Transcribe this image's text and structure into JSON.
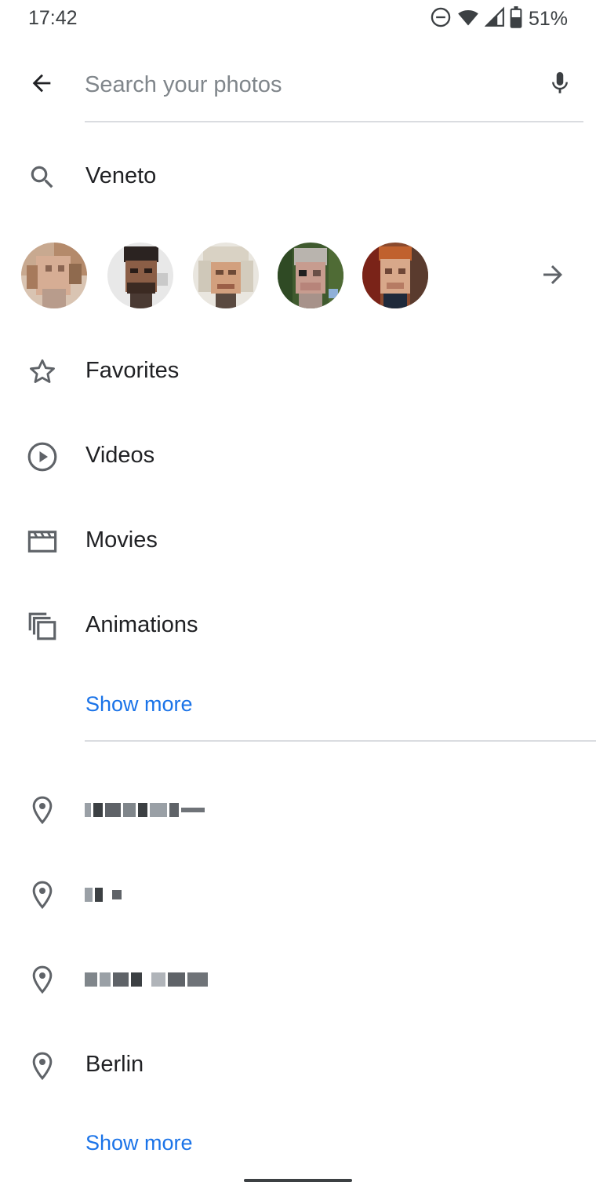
{
  "status_bar": {
    "time": "17:42",
    "battery": "51%",
    "icons": [
      "do-not-disturb-icon",
      "wifi-icon",
      "cell-signal-icon",
      "battery-icon"
    ]
  },
  "search": {
    "placeholder": "Search your photos",
    "value": ""
  },
  "suggestion": {
    "icon": "search-icon",
    "label": "Veneto"
  },
  "people": {
    "faces": [
      "face-1",
      "face-2",
      "face-3",
      "face-4",
      "face-5"
    ],
    "more_icon": "arrow-right-icon"
  },
  "categories": [
    {
      "icon": "star-outline-icon",
      "label": "Favorites"
    },
    {
      "icon": "play-circle-icon",
      "label": "Videos"
    },
    {
      "icon": "movie-clapper-icon",
      "label": "Movies"
    },
    {
      "icon": "animation-stack-icon",
      "label": "Animations"
    }
  ],
  "categories_show_more": "Show more",
  "places": [
    {
      "icon": "location-pin-icon",
      "label": "",
      "redacted": true
    },
    {
      "icon": "location-pin-icon",
      "label": "",
      "redacted": true
    },
    {
      "icon": "location-pin-icon",
      "label": "",
      "redacted": true
    },
    {
      "icon": "location-pin-icon",
      "label": "Berlin",
      "redacted": false
    }
  ],
  "places_show_more": "Show more",
  "colors": {
    "accent": "#1a73e8",
    "text": "#202124",
    "icon": "#5f6368",
    "divider": "#dadce0"
  }
}
